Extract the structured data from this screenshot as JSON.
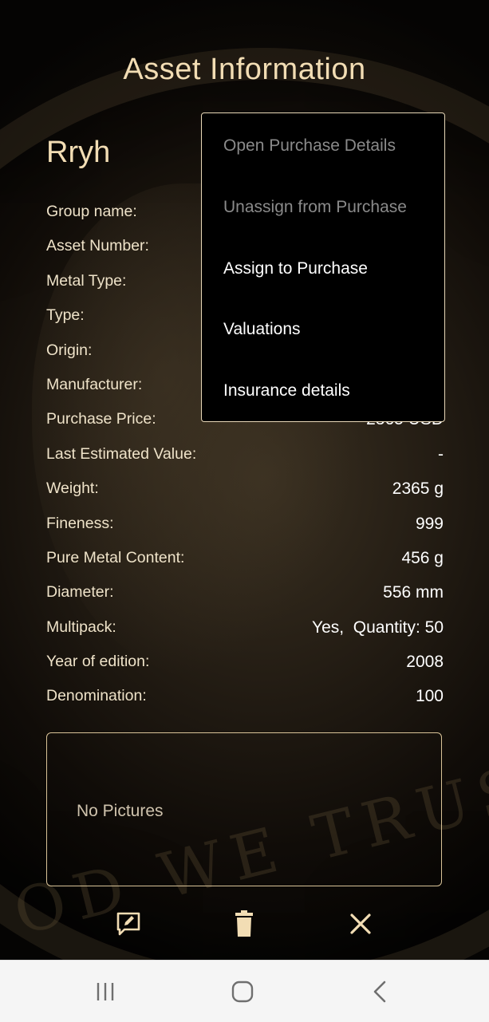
{
  "header": {
    "title": "Asset Information"
  },
  "asset": {
    "name": "Rryh",
    "fields": [
      {
        "label": "Group name:",
        "value": ""
      },
      {
        "label": "Asset Number:",
        "value": ""
      },
      {
        "label": "Metal Type:",
        "value": ""
      },
      {
        "label": "Type:",
        "value": ""
      },
      {
        "label": "Origin:",
        "value": ""
      },
      {
        "label": "Manufacturer:",
        "value": ""
      },
      {
        "label": "Purchase Price:",
        "value": "2365 USD"
      },
      {
        "label": "Last Estimated Value:",
        "value": "-"
      },
      {
        "label": "Weight:",
        "value": "2365 g"
      },
      {
        "label": "Fineness:",
        "value": "999"
      },
      {
        "label": "Pure Metal Content:",
        "value": "456 g"
      },
      {
        "label": "Diameter:",
        "value": "556 mm"
      },
      {
        "label": "Multipack:",
        "value": "Yes,  Quantity: 50"
      },
      {
        "label": "Year of edition:",
        "value": "2008"
      },
      {
        "label": "Denomination:",
        "value": "100"
      }
    ]
  },
  "pictures": {
    "empty_text": "No Pictures"
  },
  "actions": {
    "edit_icon": "edit-icon",
    "delete_icon": "trash-icon",
    "close_icon": "close-icon"
  },
  "menu": {
    "items": [
      {
        "label": "Open Purchase Details",
        "enabled": false
      },
      {
        "label": "Unassign from Purchase",
        "enabled": false
      },
      {
        "label": "Assign to Purchase",
        "enabled": true
      },
      {
        "label": "Valuations",
        "enabled": true
      },
      {
        "label": "Insurance details",
        "enabled": true
      }
    ]
  },
  "navbar": {
    "recents_icon": "recents-icon",
    "home_icon": "home-icon",
    "back_icon": "back-icon"
  },
  "colors": {
    "accent": "#F2DDB4",
    "menu_bg": "#000000",
    "disabled_text": "#8A8A8A",
    "navbar_bg": "#F5F5F5"
  }
}
